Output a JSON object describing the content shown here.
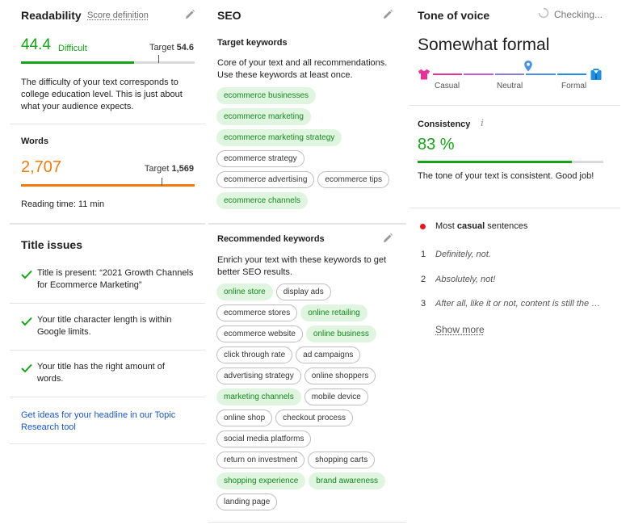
{
  "readability": {
    "title": "Readability",
    "score_definition": "Score definition",
    "score": "44.4",
    "level": "Difficult",
    "target_label": "Target",
    "target_value": "54.6",
    "score_fraction": 0.65,
    "target_fraction": 0.79,
    "description": "The difficulty of your text corresponds to college education level. This is just about what your audience expects.",
    "accent": "#16a318"
  },
  "words": {
    "title": "Words",
    "count": "2,707",
    "target_label": "Target",
    "target_value": "1,569",
    "target_fraction": 0.81,
    "reading_time": "Reading time: 11 min",
    "accent": "#f07b10"
  },
  "title_issues": {
    "title": "Title issues",
    "items": [
      "Title is present: “2021 Growth Channels for Ecommerce Marketing”",
      "Your title character length is within Google limits.",
      "Your title has the right amount of words."
    ],
    "link": "Get ideas for your headline in our Topic Research tool"
  },
  "seo": {
    "title": "SEO",
    "target_title": "Target keywords",
    "target_desc": "Core of your text and all recommendations. Use these keywords at least once.",
    "target_keywords": [
      {
        "label": "ecommerce businesses",
        "used": true
      },
      {
        "label": "ecommerce marketing",
        "used": true
      },
      {
        "label": "ecommerce marketing strategy",
        "used": true
      },
      {
        "label": "ecommerce strategy",
        "used": false
      },
      {
        "label": "ecommerce advertising",
        "used": false
      },
      {
        "label": "ecommerce tips",
        "used": false
      },
      {
        "label": "ecommerce channels",
        "used": true
      }
    ],
    "rec_title": "Recommended keywords",
    "rec_desc": "Enrich your text with these keywords to get better SEO results.",
    "rec_keywords": [
      {
        "label": "online store",
        "used": true
      },
      {
        "label": "display ads",
        "used": false
      },
      {
        "label": "ecommerce stores",
        "used": false
      },
      {
        "label": "online retailing",
        "used": true
      },
      {
        "label": "ecommerce website",
        "used": false
      },
      {
        "label": "online business",
        "used": true
      },
      {
        "label": "click through rate",
        "used": false
      },
      {
        "label": "ad campaigns",
        "used": false
      },
      {
        "label": "advertising strategy",
        "used": false
      },
      {
        "label": "online shoppers",
        "used": false
      },
      {
        "label": "marketing channels",
        "used": true
      },
      {
        "label": "mobile device",
        "used": false
      },
      {
        "label": "online shop",
        "used": false
      },
      {
        "label": "checkout process",
        "used": false
      },
      {
        "label": "social media platforms",
        "used": false
      },
      {
        "label": "return on investment",
        "used": false
      },
      {
        "label": "shopping carts",
        "used": false
      },
      {
        "label": "shopping experience",
        "used": true
      },
      {
        "label": "brand awareness",
        "used": true
      },
      {
        "label": "landing page",
        "used": false
      }
    ]
  },
  "tone": {
    "title": "Tone of voice",
    "status": "Checking...",
    "value": "Somewhat formal",
    "scale": [
      "Casual",
      "Neutral",
      "Formal"
    ],
    "marker_fraction": 0.62,
    "colors": [
      "#e5329b",
      "#c45bd0",
      "#8b7fd8",
      "#4a92de",
      "#1f8fdf"
    ]
  },
  "consistency": {
    "title": "Consistency",
    "info_icon": "info-icon",
    "value": "83 %",
    "fraction": 0.83,
    "description": "The tone of your text is consistent. Good job!",
    "accent": "#16a318"
  },
  "casual": {
    "prefix": "Most ",
    "bold": "casual",
    "suffix": " sentences",
    "sentences": [
      {
        "n": "1",
        "text": "Definitely, not."
      },
      {
        "n": "2",
        "text": "Absolutely, not!"
      },
      {
        "n": "3",
        "text": "After all, like it or not, content is still the king"
      }
    ],
    "show_more": "Show more"
  }
}
